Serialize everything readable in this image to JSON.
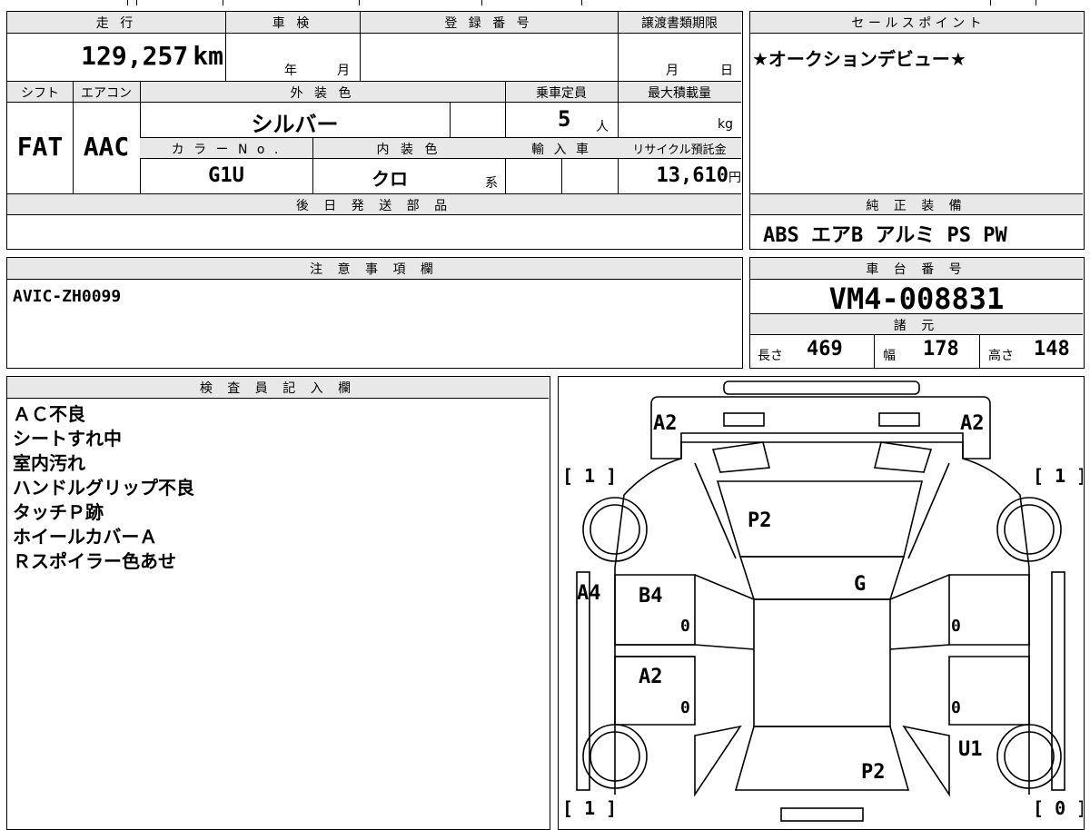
{
  "header": {
    "mileage_label": "走 行",
    "inspection_label": "車 検",
    "registration_label": "登 録 番 号",
    "transfer_deadline_label": "譲渡書類期限",
    "sales_point_label": "セ ー ル ス ポ イ ン ト"
  },
  "mileage": {
    "value": "129,257",
    "unit": "km"
  },
  "inspection": {
    "year": "年",
    "month": "月"
  },
  "transfer_deadline": {
    "month": "月",
    "day": "日"
  },
  "sales_point": {
    "text": "★オークションデビュー★"
  },
  "row2_labels": {
    "shift": "シフト",
    "aircon": "エアコン",
    "exterior_color": "外 装 色",
    "capacity": "乗車定員",
    "max_load": "最大積載量"
  },
  "shift": {
    "value": "FAT"
  },
  "aircon": {
    "value": "AAC"
  },
  "exterior_color": {
    "value": "シルバー"
  },
  "capacity": {
    "value": "5",
    "unit": "人"
  },
  "max_load": {
    "unit": "kg"
  },
  "row3_labels": {
    "color_no": "カ ラ ー N o .",
    "interior_color": "内 装 色",
    "imported": "輸 入 車",
    "recycle": "リサイクル預託金"
  },
  "color_no": {
    "value": "G1U"
  },
  "interior_color": {
    "value": "クロ",
    "suffix": "系"
  },
  "recycle": {
    "value": "13,610",
    "unit": "円"
  },
  "later_parts": {
    "label": "後 日 発 送 部 品"
  },
  "equipment": {
    "label": "純 正 装 備",
    "value": "ABS エアB アルミ PS PW"
  },
  "notes": {
    "label": "注 意 事 項 欄",
    "value": "AVIC-ZH0099"
  },
  "chassis": {
    "label": "車 台 番 号",
    "value": "VM4-008831"
  },
  "specs": {
    "label": "諸 元",
    "length_label": "長さ",
    "length": "469",
    "width_label": "幅",
    "width": "178",
    "height_label": "高さ",
    "height": "148"
  },
  "inspector": {
    "label": "検 査 員 記 入 欄",
    "lines": [
      "ＡＣ不良",
      "シートすれ中",
      "室内汚れ",
      "ハンドルグリップ不良",
      "タッチＰ跡",
      "ホイールカバーＡ",
      "Ｒスポイラー色あせ"
    ]
  },
  "diagram": {
    "marks": [
      "A2",
      "A2",
      "[ 1 ]",
      "[ 1 ]",
      "P2",
      "A4",
      "B4",
      "G",
      "0",
      "0",
      "A2",
      "0",
      "0",
      "U1",
      "P2",
      "[ 1 ]",
      "[ 0 ]"
    ]
  }
}
